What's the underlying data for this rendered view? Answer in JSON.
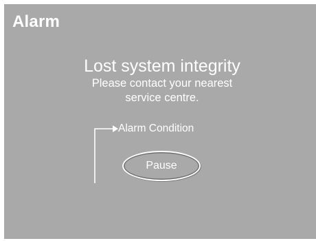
{
  "window": {
    "title": "Alarm"
  },
  "alarm": {
    "headline": "Lost system integrity",
    "line1": "Please contact your nearest",
    "line2": "service centre."
  },
  "flow": {
    "condition_label": "Alarm Condition"
  },
  "actions": {
    "pause_label": "Pause"
  },
  "colors": {
    "background": "#a9a9aa",
    "text": "#ffffff"
  }
}
